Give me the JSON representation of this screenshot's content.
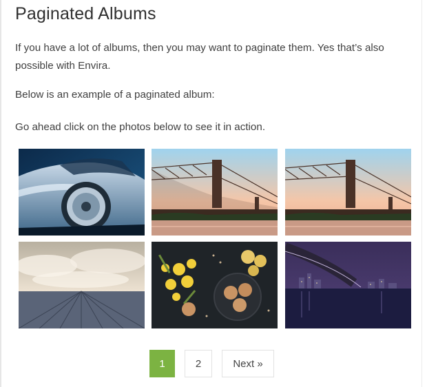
{
  "page": {
    "title": "Paginated Albums",
    "paragraphs": [
      "If you have a lot of albums, then you may want to paginate them. Yes that’s also possible with Envira.",
      "Below is an example of a paginated album:",
      "Go ahead click on the photos below to see it in action."
    ]
  },
  "albums": [
    {
      "subject": "sports-car"
    },
    {
      "subject": "bridge-sunset"
    },
    {
      "subject": "bridge-sunset"
    },
    {
      "subject": "cloudy-sky-wooden-deck"
    },
    {
      "subject": "flowers-and-cookies"
    },
    {
      "subject": "bridge-at-night"
    }
  ],
  "pagination": {
    "pages": [
      "1",
      "2"
    ],
    "current": "1",
    "next_label": "Next »",
    "active_color": "#7cb342"
  }
}
